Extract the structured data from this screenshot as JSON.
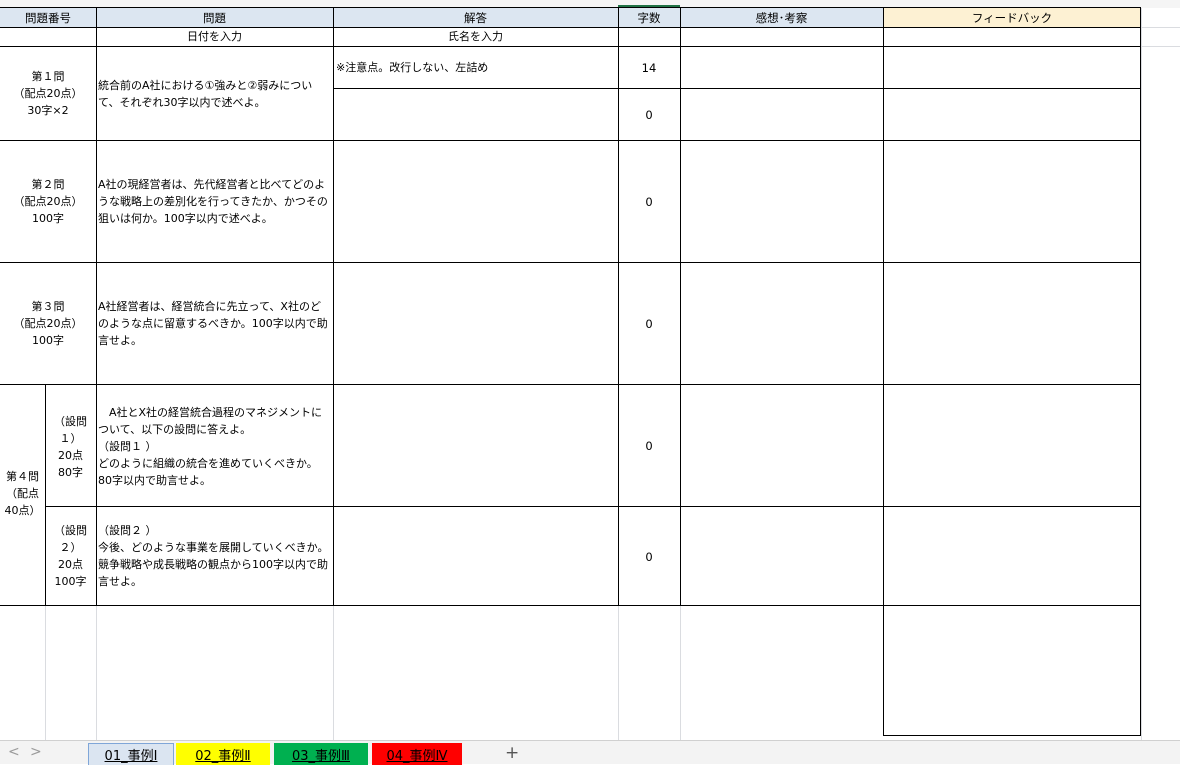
{
  "header": {
    "col_a": "問題番号",
    "col_b": "問題",
    "col_c": "解答",
    "col_d": "字数",
    "col_e": "感想･考察",
    "col_f": "フィードバック"
  },
  "row2": {
    "date_input": "日付を入力",
    "name_input": "氏名を入力"
  },
  "q1": {
    "label": "第１問\n（配点20点）\n30字×2",
    "text": "統合前のA社における①強みと②弱みについて、それぞれ30字以内で述べよ。",
    "answer1": "※注意点。改行しない、左詰め",
    "count1": "14",
    "count2": "0"
  },
  "q2": {
    "label": "第２問\n（配点20点）\n100字",
    "text": "A社の現経営者は、先代経営者と比べてどのような戦略上の差別化を行ってきたか、かつその狙いは何か。100字以内で述べよ。",
    "count": "0"
  },
  "q3": {
    "label": "第３問\n（配点20点）\n100字",
    "text": "A社経営者は、経営統合に先立って、X社のどのような点に留意するべきか。100字以内で助言せよ。",
    "count": "0"
  },
  "q4": {
    "label": "第４問\n（配点\n40点）",
    "sub1_label": "（設問\n１）\n20点\n80字",
    "sub1_text": "　A社とX社の経営統合過程のマネジメントについて、以下の設問に答えよ。\n（設問１ ）\nどのように組織の統合を進めていくべきか。80字以内で助言せよ。",
    "sub1_count": "0",
    "sub2_label": "（設問\n２）\n20点\n100字",
    "sub2_text": "（設問２ ）\n今後、どのような事業を展開していくべきか。競争戦略や成長戦略の観点から100字以内で助言せよ。",
    "sub2_count": "0"
  },
  "tabs": [
    {
      "label": "01_事例Ⅰ",
      "color": "#dbe5f1"
    },
    {
      "label": "02_事例Ⅱ",
      "color": "#ffff00"
    },
    {
      "label": "03_事例Ⅲ",
      "color": "#00b050"
    },
    {
      "label": "04_事例Ⅳ",
      "color": "#ff0000"
    }
  ],
  "nav": {
    "prev": "<",
    "next": ">",
    "add": "+"
  },
  "colors": {
    "header_bg": "#dce6f1",
    "feedback_header_bg": "#fdf1d3"
  }
}
